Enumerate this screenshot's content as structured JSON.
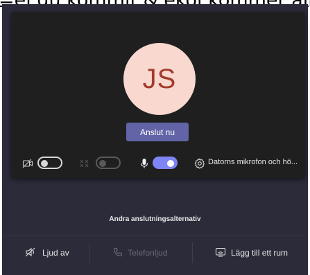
{
  "banner": {
    "text": "=el du kommit & ekoi kommer allt"
  },
  "preview": {
    "avatar_initials": "JS",
    "join_button": "Anslut nu",
    "device_label": "Datorns mikrofon och hö...",
    "camera": {
      "state": "off"
    },
    "background_effects": {
      "state": "disabled"
    },
    "microphone": {
      "state": "on"
    }
  },
  "other_options": {
    "title": "Andra anslutningsalternativ",
    "items": [
      {
        "label": "Ljud av",
        "icon": "speaker-muted-icon",
        "enabled": true
      },
      {
        "label": "Telefonljud",
        "icon": "phone-icon",
        "enabled": false
      },
      {
        "label": "Lägg till ett rum",
        "icon": "room-cast-icon",
        "enabled": true
      }
    ]
  },
  "colors": {
    "app_background": "#2b2b3a",
    "preview_background": "#1f1f1f",
    "accent": "#6264a7",
    "toggle_on": "#7f85f5",
    "avatar_background": "#f8d8cf",
    "avatar_text": "#a33b2a"
  }
}
